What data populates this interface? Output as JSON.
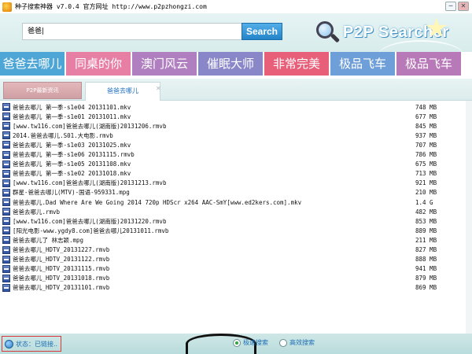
{
  "window": {
    "title": "种子搜索神器  v7.0.4 官方网址 http://www.p2pzhongzi.com",
    "minimize_label": "─",
    "close_label": "✕"
  },
  "header": {
    "search_value": "爸爸|",
    "search_button": "Search",
    "logo_text": "P2P Searcher",
    "star_glyph": "★"
  },
  "keywords": [
    {
      "label": "爸爸去哪儿",
      "color": "#4ea6d6"
    },
    {
      "label": "同桌的你",
      "color": "#e67fa3"
    },
    {
      "label": "澳门风云",
      "color": "#b07fc0"
    },
    {
      "label": "催眠大师",
      "color": "#8a87c9"
    },
    {
      "label": "非常完美",
      "color": "#e85f7a"
    },
    {
      "label": "极品飞车",
      "color": "#6f9fd8"
    },
    {
      "label": "极品飞车",
      "color": "#b879b8"
    }
  ],
  "tabs": {
    "news": "P2P最新资讯",
    "active": "爸爸去哪儿",
    "close_glyph": "✕"
  },
  "files": [
    {
      "name": "爸爸去哪儿 第一季-s1e04 20131101.mkv",
      "size": "748 MB"
    },
    {
      "name": "爸爸去哪儿 第一季-s1e01 20131011.mkv",
      "size": "677 MB"
    },
    {
      "name": "[www.tw116.com]爸爸去哪儿(湖南版)20131206.rmvb",
      "size": "845 MB"
    },
    {
      "name": "2014.爸爸去哪儿.S01.大电影.rmvb",
      "size": "937 MB"
    },
    {
      "name": "爸爸去哪儿 第一季-s1e03 20131025.mkv",
      "size": "707 MB"
    },
    {
      "name": "爸爸去哪儿 第一季-s1e06 20131115.rmvb",
      "size": "786 MB"
    },
    {
      "name": "爸爸去哪儿 第一季-s1e05 20131108.mkv",
      "size": "675 MB"
    },
    {
      "name": "爸爸去哪儿 第一季-s1e02 20131018.mkv",
      "size": "713 MB"
    },
    {
      "name": "[www.tw116.com]爸爸去哪儿(湖南版)20131213.rmvb",
      "size": "921 MB"
    },
    {
      "name": "群星-爸爸去哪儿(MTV)-国语-959331.mpg",
      "size": "210 MB"
    },
    {
      "name": "爸爸去哪儿.Dad Where Are We Going 2014 720p HDScr x264 AAC-SmY[www.ed2kers.com].mkv",
      "size": "1.4 G"
    },
    {
      "name": "爸爸去哪儿.rmvb",
      "size": "482 MB"
    },
    {
      "name": "[www.tw116.com]爸爸去哪儿(湖南版)20131220.rmvb",
      "size": "853 MB"
    },
    {
      "name": "[阳光电影-www.ygdy8.com]爸爸去哪儿20131011.rmvb",
      "size": "889 MB"
    },
    {
      "name": "爸爸去哪儿了 林志颖.mpg",
      "size": "211 MB"
    },
    {
      "name": "爸爸去哪儿_HDTV_20131227.rmvb",
      "size": "827 MB"
    },
    {
      "name": "爸爸去哪儿_HDTV_20131122.rmvb",
      "size": "888 MB"
    },
    {
      "name": "爸爸去哪儿_HDTV_20131115.rmvb",
      "size": "941 MB"
    },
    {
      "name": "爸爸去哪儿_HDTV_20131018.rmvb",
      "size": "879 MB"
    },
    {
      "name": "爸爸去哪儿_HDTV_20131101.rmvb",
      "size": "869 MB"
    }
  ],
  "status": {
    "text": "状态：已链接..",
    "mode_fast": "极速搜索",
    "mode_efficient": "高效搜索",
    "selected_mode": "mode_fast"
  }
}
